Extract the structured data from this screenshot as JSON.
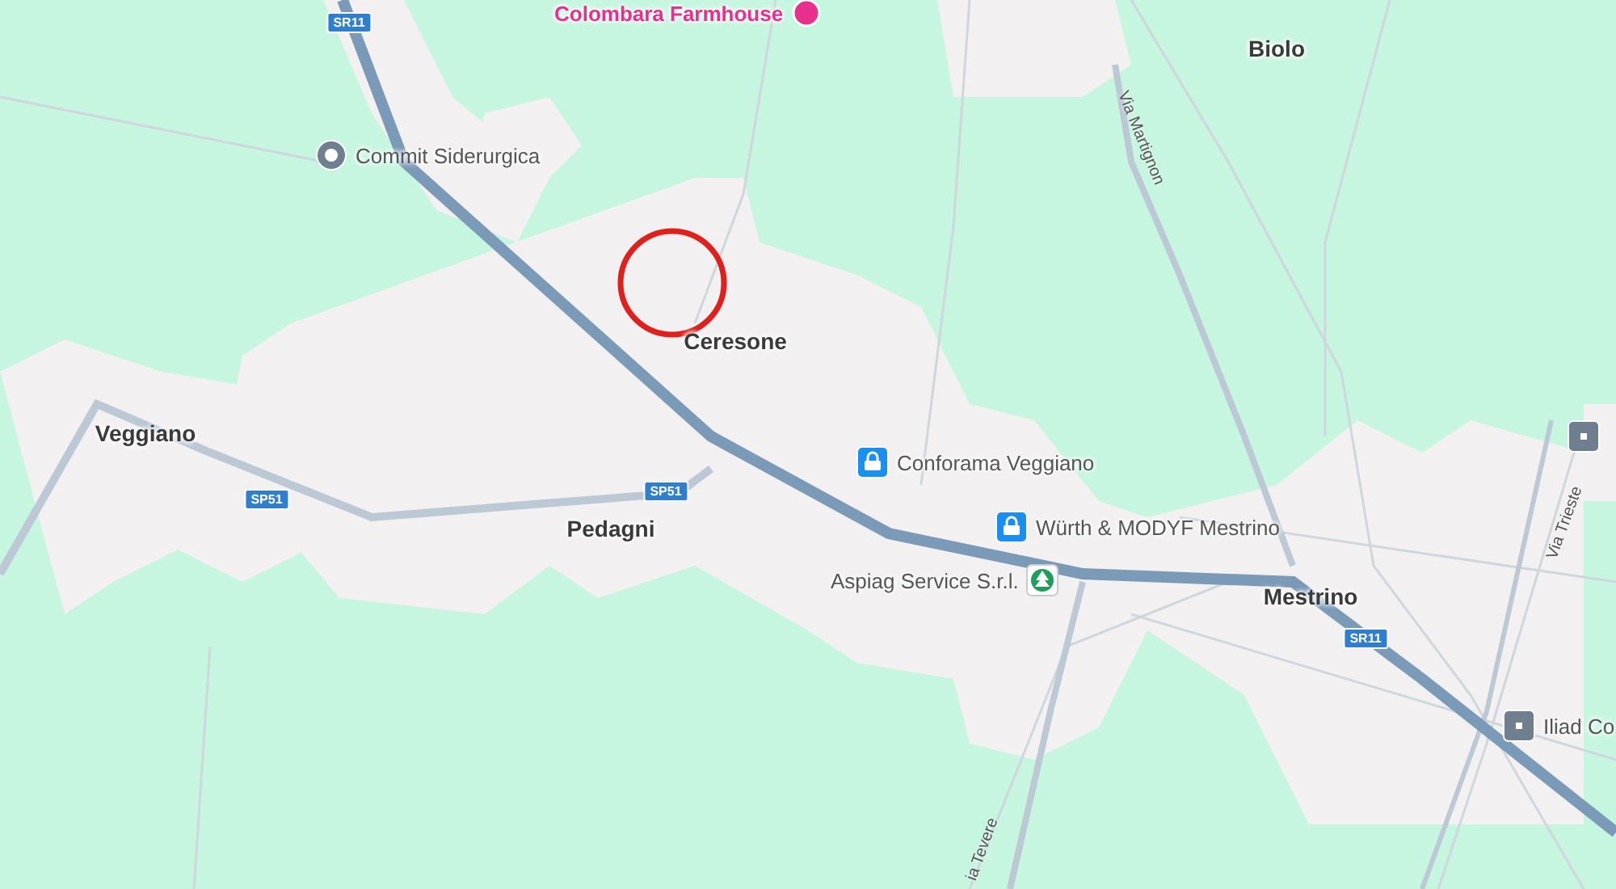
{
  "map": {
    "towns": [
      {
        "name": "Biolo"
      },
      {
        "name": "Ceresone"
      },
      {
        "name": "Veggiano"
      },
      {
        "name": "Pedagni"
      },
      {
        "name": "Mestrino"
      }
    ],
    "places": [
      {
        "name": "Colombara Farmhouse",
        "kind": "pin"
      },
      {
        "name": "Commit Siderurgica",
        "kind": "landmark"
      },
      {
        "name": "Conforama Veggiano",
        "kind": "shop"
      },
      {
        "name": "Würth & MODYF Mestrino",
        "kind": "shop"
      },
      {
        "name": "Aspiag Service S.r.l.",
        "kind": "grocery"
      },
      {
        "name": "Iliad Co",
        "kind": "building"
      },
      {
        "kind": "building"
      }
    ],
    "road_shields": [
      "SR11",
      "SP51",
      "SP51",
      "SR11"
    ],
    "streets": [
      "Via Martignon",
      "Via Trieste",
      "ia Tevere"
    ]
  }
}
